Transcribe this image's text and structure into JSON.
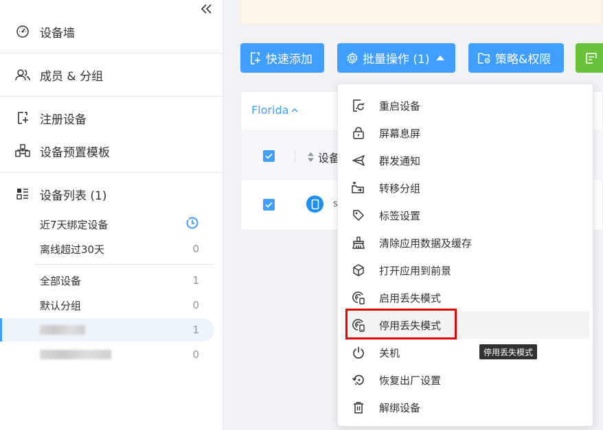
{
  "sidebar": {
    "nav": [
      {
        "label": "设备墙",
        "icon": "dashboard-icon"
      },
      {
        "label": "成员 & 分组",
        "icon": "users-icon"
      },
      {
        "label": "注册设备",
        "icon": "register-device-icon"
      },
      {
        "label": "设备预置模板",
        "icon": "template-icon"
      },
      {
        "label": "设备列表 (1)",
        "icon": "list-icon"
      }
    ],
    "groups": [
      {
        "label": "近7天绑定设备",
        "count": ""
      },
      {
        "label": "离线超过30天",
        "count": "0"
      },
      {
        "label": "全部设备",
        "count": "1"
      },
      {
        "label": "默认分组",
        "count": "0"
      },
      {
        "label": "",
        "count": "1"
      },
      {
        "label": "",
        "count": "0"
      }
    ]
  },
  "toolbar": {
    "quick_add": "快速添加",
    "batch_ops": "批量操作 (1)",
    "policy": "策略&权限"
  },
  "table": {
    "tab_label": "Florida",
    "head_label": "设备",
    "row_text": "s"
  },
  "dropdown": {
    "items": [
      {
        "label": "重启设备",
        "icon": "restart-device-icon"
      },
      {
        "label": "屏幕息屏",
        "icon": "lock-screen-icon"
      },
      {
        "label": "群发通知",
        "icon": "send-notification-icon"
      },
      {
        "label": "转移分组",
        "icon": "move-folder-icon"
      },
      {
        "label": "标签设置",
        "icon": "tag-icon"
      },
      {
        "label": "清除应用数据及缓存",
        "icon": "clear-data-icon"
      },
      {
        "label": "打开应用到前景",
        "icon": "open-app-icon"
      },
      {
        "label": "启用丢失模式",
        "icon": "enable-lost-mode-icon"
      },
      {
        "label": "停用丢失模式",
        "icon": "disable-lost-mode-icon"
      },
      {
        "label": "关机",
        "icon": "power-icon"
      },
      {
        "label": "恢复出厂设置",
        "icon": "factory-reset-icon"
      },
      {
        "label": "解绑设备",
        "icon": "unbind-device-icon"
      }
    ],
    "tooltip": "停用丢失模式"
  },
  "colors": {
    "primary": "#409eff",
    "success": "#67c23a",
    "highlight": "#e60000"
  }
}
